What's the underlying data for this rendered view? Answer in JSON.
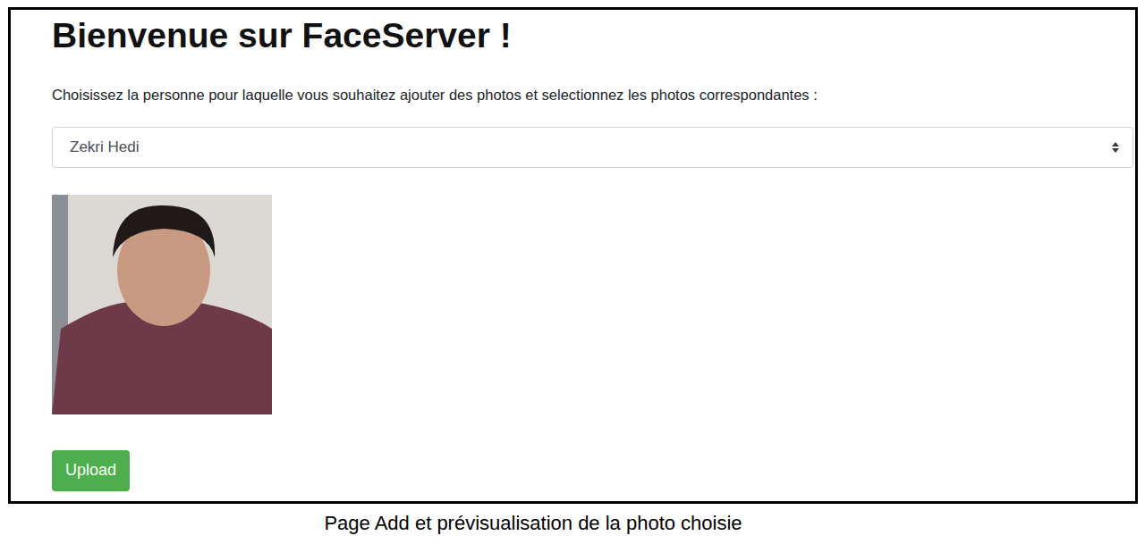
{
  "page": {
    "title": "Bienvenue sur FaceServer !",
    "instruction": "Choisissez la personne pour laquelle vous souhaitez ajouter des photos et selectionnez les photos correspondantes :",
    "person_select": {
      "value": "Zekri Hedi"
    },
    "upload_button": "Upload"
  },
  "caption": "Page Add et prévisualisation de la photo choisie"
}
